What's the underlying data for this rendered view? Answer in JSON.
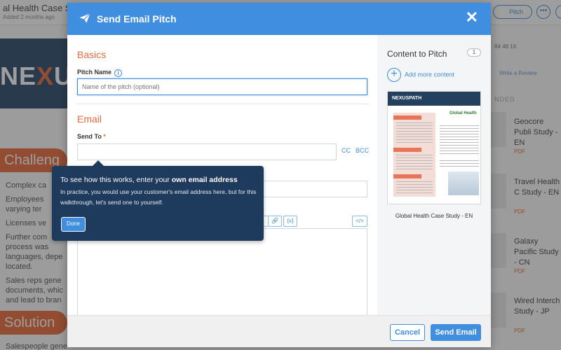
{
  "background": {
    "title": "al Health Case Study",
    "subtitle": "Added 2 months ago",
    "pitch_button": "Pitch",
    "hero_logo_left": "NE",
    "hero_logo_x": "X",
    "hero_logo_right": "U",
    "challenge_label": "Challeng",
    "solution_label": "Solution",
    "bullets": [
      "Complex ca",
      "Employees varying ter",
      "Licenses ve",
      "Further com process was languages, depe located.",
      "Sales reps gene documents, whic and lead to bran"
    ],
    "bottom_text": "Salespeople gene",
    "stats": "84   48   16",
    "write_review": "Write a Review",
    "recommended": "NDED",
    "cards": [
      {
        "title": "Geocore Publi Study - EN",
        "type": "PDF"
      },
      {
        "title": "Travel Health C Study - EN",
        "type": "PDF"
      },
      {
        "title": "Galaxy Pacific Study - CN",
        "type": "PDF"
      },
      {
        "title": "Wired Interch Study - JP",
        "type": "PDF"
      }
    ]
  },
  "modal": {
    "title": "Send Email Pitch",
    "close": "✕",
    "basics_title": "Basics",
    "pitch_name_label": "Pitch Name",
    "pitch_name_placeholder": "Name of the pitch (optional)",
    "pitch_name_value": "",
    "email_title": "Email",
    "send_to_label": "Send To",
    "send_to_required": "*",
    "send_to_value": "",
    "cc_label": "CC",
    "bcc_label": "BCC",
    "subject_value": "",
    "link_icon_label": "🔗",
    "variable_label": "{x}",
    "code_label": "</>",
    "content_title": "Content to Pitch",
    "content_count": "1",
    "add_more": "Add more content",
    "doc_name": "Global Health Case Study - EN",
    "doc_logo": "NEXUSPATH",
    "doc_logo_x": "X",
    "doc_brand": "Global Health",
    "cancel": "Cancel",
    "send": "Send Email"
  },
  "tooltip": {
    "title_prefix": "To see how this works, enter your ",
    "title_bold": "own email address",
    "body": "In practice, you would use your customer's email address here, but for this walkthrough, let's send one to yourself.",
    "done": "Done"
  },
  "colors": {
    "accent": "#3f8ee0",
    "brand_orange": "#e86a3a",
    "tooltip_bg": "#1e3a5c"
  }
}
